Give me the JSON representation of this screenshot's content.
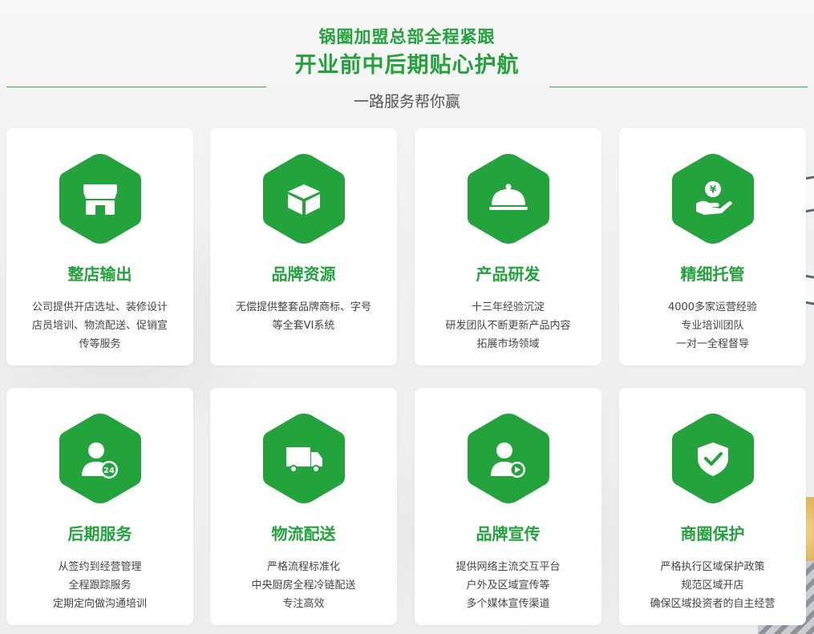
{
  "header": {
    "title_line1": "锅圈加盟总部全程紧跟",
    "title_line2": "开业前中后期贴心护航",
    "subtitle": "一路服务帮你赢"
  },
  "colors": {
    "accent": "#22a33b",
    "text": "#444444"
  },
  "cards": [
    {
      "icon": "store-icon",
      "title": "整店输出",
      "lines": [
        "公司提供开店选址、装修设计",
        "店员培训、物流配送、促销宣",
        "传等服务"
      ]
    },
    {
      "icon": "box-icon",
      "title": "品牌资源",
      "lines": [
        "无偿提供整套品牌商标、字号",
        "等全套VI系统"
      ]
    },
    {
      "icon": "food-cloche-icon",
      "title": "产品研发",
      "lines": [
        "十三年经验沉淀",
        "研发团队不断更新产品内容",
        "拓展市场领域"
      ]
    },
    {
      "icon": "yen-hand-icon",
      "title": "精细托管",
      "lines": [
        "4000多家运营经验",
        "专业培训团队",
        "一对一全程督导"
      ]
    },
    {
      "icon": "user-24-icon",
      "title": "后期服务",
      "lines": [
        "从签约到经营管理",
        "全程跟踪服务",
        "定期定向做沟通培训"
      ]
    },
    {
      "icon": "truck-icon",
      "title": "物流配送",
      "lines": [
        "严格流程标准化",
        "中央厨房全程冷链配送",
        "专注高效"
      ]
    },
    {
      "icon": "user-play-icon",
      "title": "品牌宣传",
      "lines": [
        "提供网络主流交互平台",
        "户外及区域宣传等",
        "多个媒体宣传渠道"
      ]
    },
    {
      "icon": "shield-check-icon",
      "title": "商圈保护",
      "lines": [
        "严格执行区域保护政策",
        "规范区域开店",
        "确保区域投资者的自主经营"
      ]
    }
  ]
}
